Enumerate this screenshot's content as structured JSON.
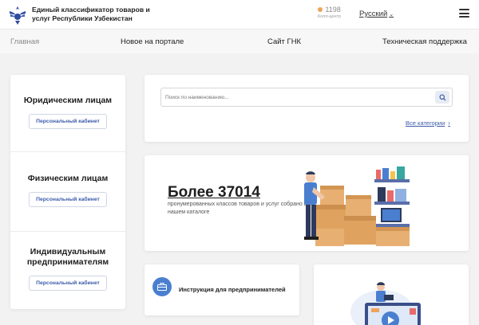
{
  "header": {
    "title_line1": "Единый классификатор товаров и",
    "title_line2": "услуг Республики Узбекистан",
    "call_number": "1198",
    "call_label": "Колл-центр",
    "language": "Русский"
  },
  "nav": {
    "items": [
      "Главная",
      "Новое на портале",
      "Сайт ГНК",
      "Техническая поддержка"
    ]
  },
  "sidebar": {
    "segments": [
      {
        "title_line1": "Юридическим лицам",
        "title_line2": "",
        "button": "Персональный кабинет"
      },
      {
        "title_line1": "Физическим лицам",
        "title_line2": "",
        "button": "Персональный кабинет"
      },
      {
        "title_line1": "Индивидуальным",
        "title_line2": "предпринимателям",
        "button": "Персональный кабинет"
      }
    ]
  },
  "search": {
    "placeholder": "Поиск по наименованию...",
    "all_categories": "Все категории"
  },
  "stats": {
    "number": "Более 37014",
    "desc": "пронумерованных классов товаров и услуг собрано в нашем каталоге"
  },
  "instructions": {
    "label": "Инструкция для предпринимателей"
  },
  "colors": {
    "accent": "#3b5ba9",
    "box": "#e0a35f",
    "icon_blue": "#4a7fd0"
  }
}
